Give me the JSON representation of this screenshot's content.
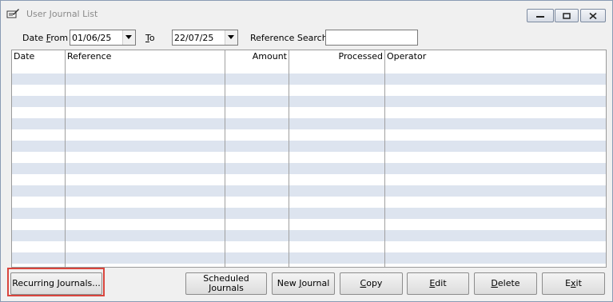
{
  "window": {
    "title": "User Journal List",
    "icon": "journal-pencil-icon",
    "controls": {
      "minimize": "minimize-icon",
      "restore": "restore-icon",
      "close": "close-icon"
    }
  },
  "filters": {
    "date_from_label_prefix": "Date ",
    "date_from_label_key": "F",
    "date_from_label_suffix": "rom",
    "date_from_value": "01/06/25",
    "to_label_key": "T",
    "to_label_suffix": "o",
    "date_to_value": "22/07/25",
    "reference_search_label": "Reference Search",
    "reference_search_value": ""
  },
  "table": {
    "columns": [
      "Date",
      "Reference",
      "Amount",
      "Processed",
      "Operator"
    ],
    "rows": []
  },
  "buttons": {
    "recurring": "Recurring Journals...",
    "scheduled_line1": "Scheduled",
    "scheduled_line2": "Journals",
    "new_prefix": "New ",
    "new_key": "J",
    "new_suffix": "ournal",
    "copy_key": "C",
    "copy_suffix": "opy",
    "edit_key": "E",
    "edit_suffix": "dit",
    "delete_key": "D",
    "delete_suffix": "elete",
    "exit_prefix": "E",
    "exit_key": "x",
    "exit_suffix": "it"
  },
  "colors": {
    "alt_row": "#dde4ef",
    "highlight": "#d9453d",
    "title_text": "#8a8a8a"
  }
}
